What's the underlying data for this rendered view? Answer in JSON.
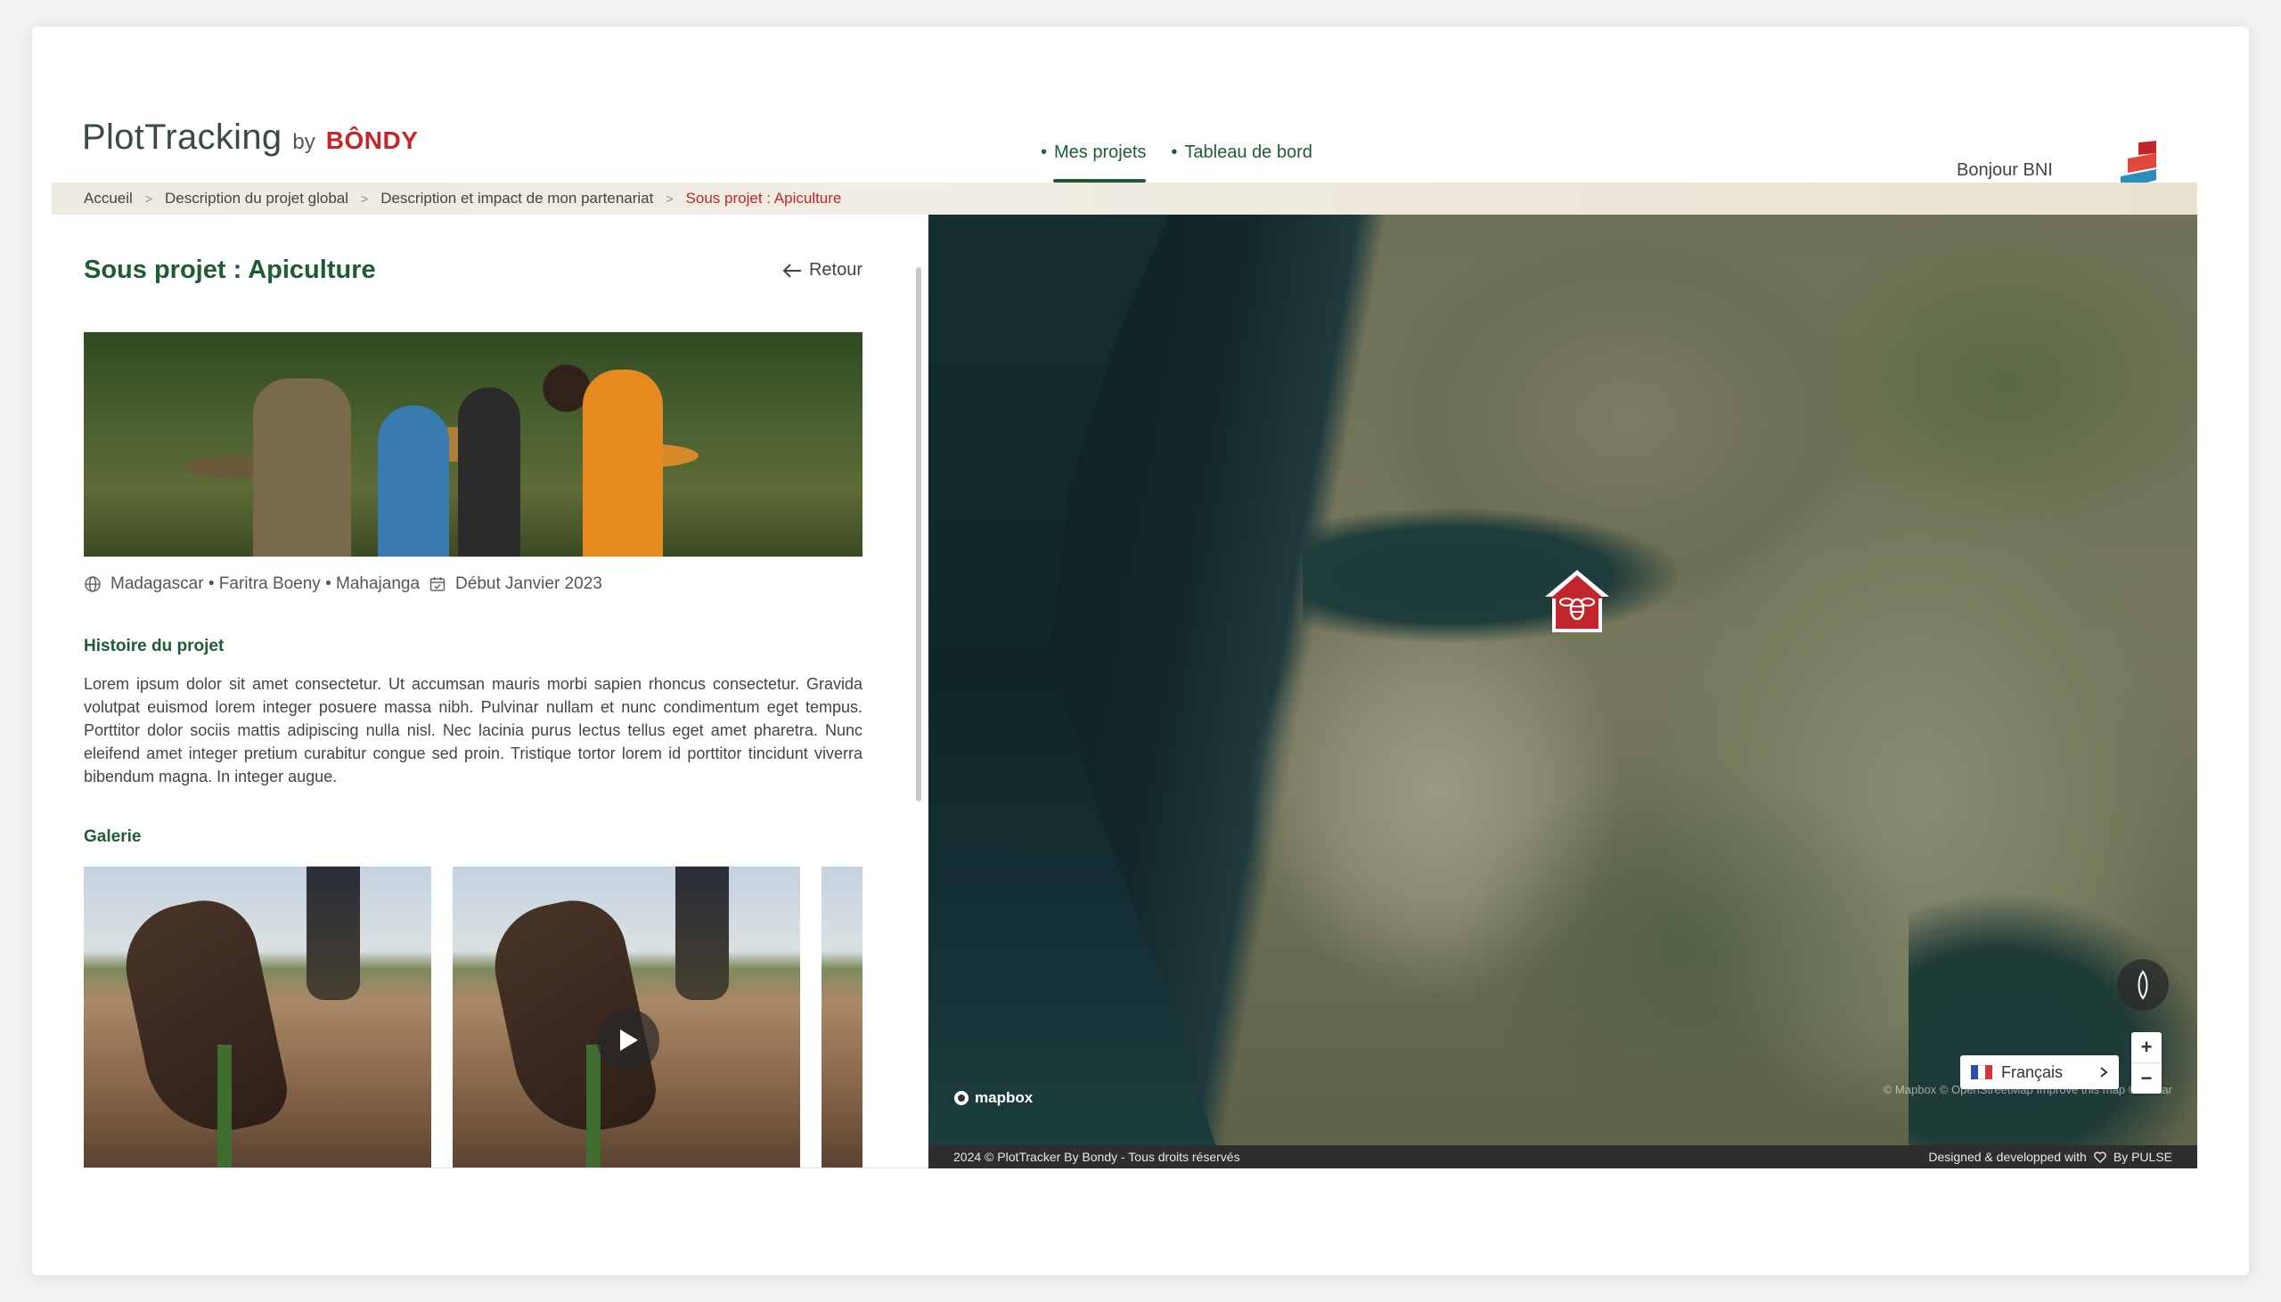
{
  "header": {
    "logo_main": "PlotTracking",
    "logo_by": "by",
    "logo_brand": "BÔNDY",
    "nav": [
      {
        "label": "Mes projets",
        "active": true
      },
      {
        "label": "Tableau de bord",
        "active": false
      }
    ],
    "nav_bullet": "•",
    "greeting": "Bonjour BNI"
  },
  "breadcrumb": {
    "items": [
      "Accueil",
      "Description du projet global",
      "Description et impact de mon partenariat"
    ],
    "current": "Sous projet : Apiculture",
    "separator": ">"
  },
  "project": {
    "title": "Sous projet : Apiculture",
    "back_label": "Retour",
    "location": "Madagascar • Faritra Boeny • Mahajanga",
    "start_date": "Début Janvier 2023",
    "story_heading": "Histoire du projet",
    "story_text": "Lorem ipsum dolor sit amet consectetur. Ut accumsan mauris morbi sapien rhoncus consectetur. Gravida volutpat euismod lorem integer posuere massa nibh. Pulvinar nullam et nunc condimentum eget tempus. Porttitor dolor sociis mattis adipiscing nulla nisl. Nec lacinia purus lectus tellus eget amet pharetra. Nunc eleifend amet integer pretium curabitur congue sed proin. Tristique tortor lorem id porttitor tincidunt viverra bibendum magna. In integer augue.",
    "gallery_heading": "Galerie"
  },
  "map": {
    "provider_logo": "mapbox",
    "attribution": "© Mapbox © OpenStreetMap Improve this map © Maxar",
    "language": "Français",
    "zoom_in": "+",
    "zoom_out": "−",
    "marker_icon": "bee-icon"
  },
  "footer": {
    "left": "2024 © PlotTracker By Bondy - Tous droits réservés",
    "right_prefix": "Designed & developped with",
    "right_suffix": "By PULSE"
  },
  "colors": {
    "primary_green": "#1f5c33",
    "brand_red": "#c0262b",
    "footer_bg": "#2e2e2e"
  }
}
